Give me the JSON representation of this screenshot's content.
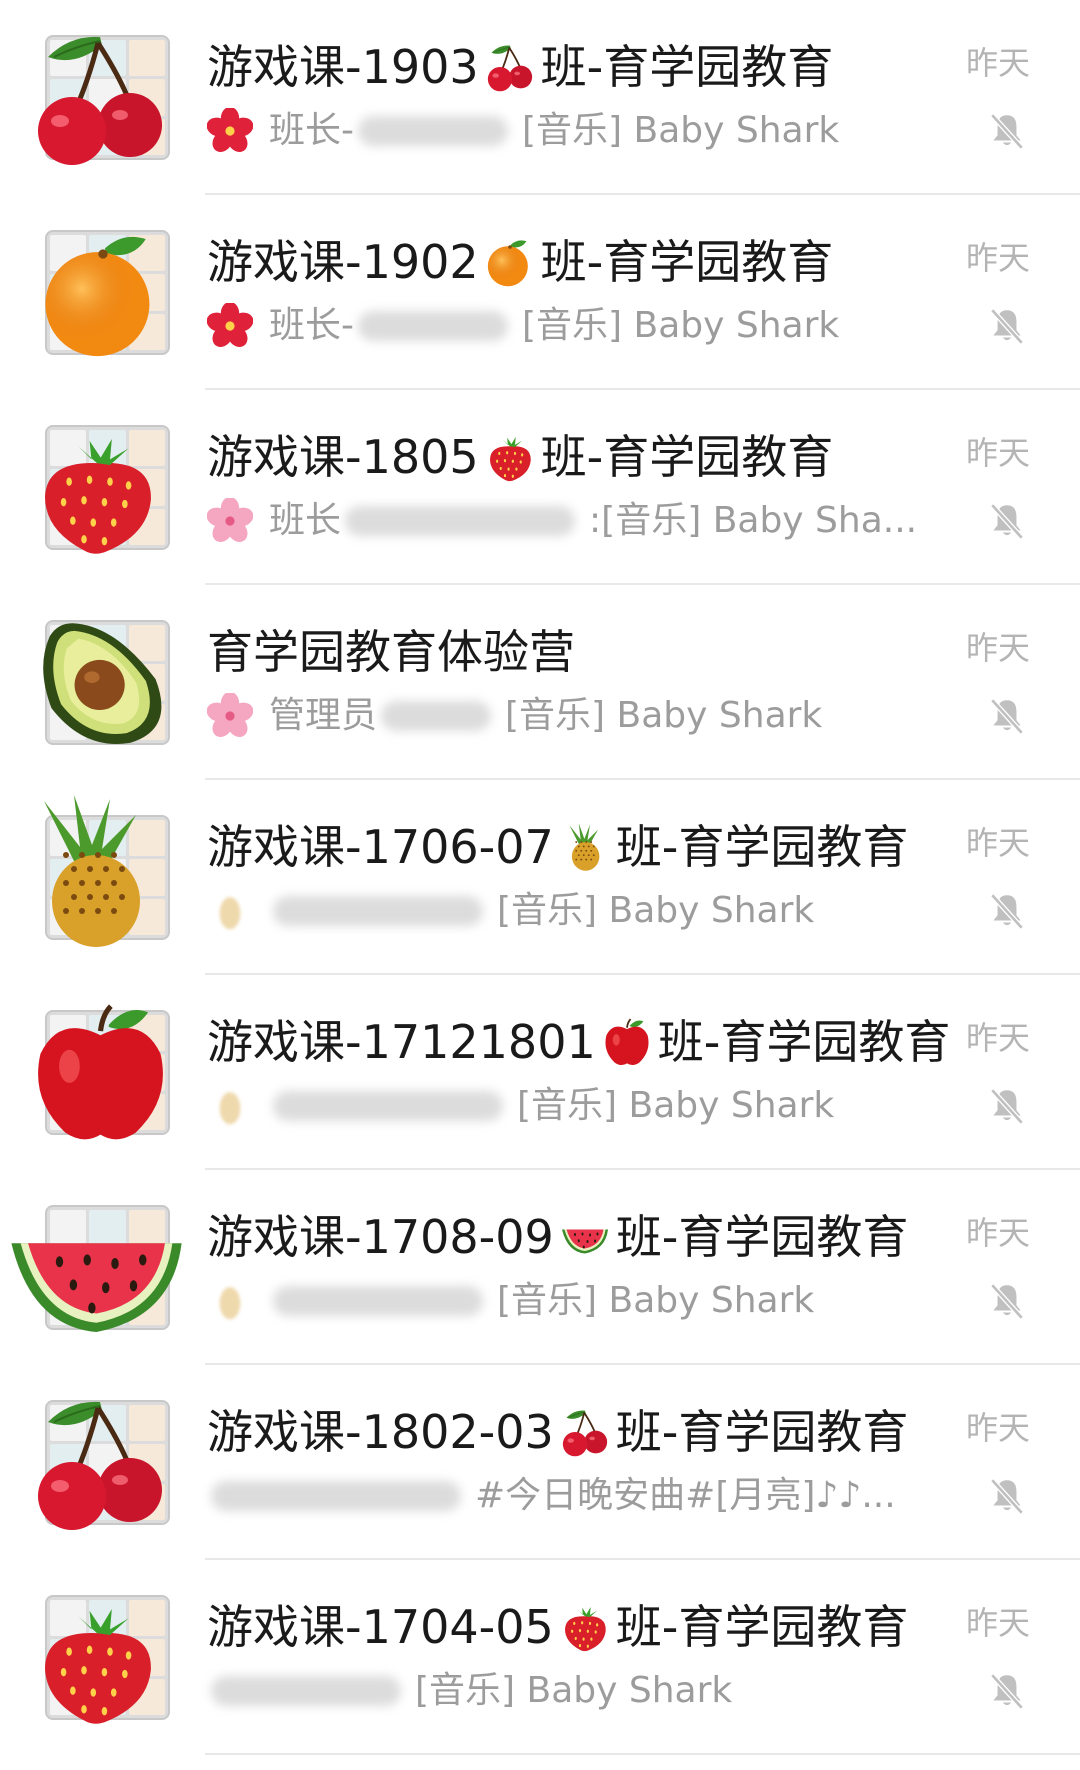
{
  "chats": [
    {
      "title": "游戏课-1903",
      "title_suffix": "班-育学园教育",
      "title_emoji": "cherry-icon",
      "time": "昨天",
      "preview_icon": "hibiscus-icon",
      "preview_role": "班长-",
      "preview_sep": "",
      "preview_text": "[音乐] Baby Shark",
      "muted": true,
      "avatar_fruit": "cherry"
    },
    {
      "title": "游戏课-1902",
      "title_suffix": "班-育学园教育",
      "title_emoji": "orange-icon",
      "time": "昨天",
      "preview_icon": "hibiscus-icon",
      "preview_role": "班长-",
      "preview_sep": "",
      "preview_text": "[音乐] Baby Shark",
      "muted": true,
      "avatar_fruit": "orange"
    },
    {
      "title": "游戏课-1805",
      "title_suffix": "班-育学园教育",
      "title_emoji": "strawberry-icon",
      "time": "昨天",
      "preview_icon": "cherry-blossom-icon",
      "preview_role": "班长",
      "preview_sep": ":",
      "preview_text": "[音乐] Baby Sha...",
      "muted": true,
      "avatar_fruit": "strawberry"
    },
    {
      "title": "育学园教育体验营",
      "title_suffix": "",
      "title_emoji": "",
      "time": "昨天",
      "preview_icon": "cherry-blossom-icon",
      "preview_role": "管理员",
      "preview_sep": "",
      "preview_text": "[音乐] Baby Shark",
      "muted": true,
      "avatar_fruit": "avocado"
    },
    {
      "title": "游戏课-1706-07",
      "title_suffix": "班-育学园教育",
      "title_emoji": "pineapple-icon",
      "time": "昨天",
      "preview_icon": "blurred-icon",
      "preview_role": "",
      "preview_sep": "",
      "preview_text": "[音乐] Baby Shark",
      "muted": true,
      "avatar_fruit": "pineapple"
    },
    {
      "title": "游戏课-17121801",
      "title_suffix": "班-育学园教育",
      "title_emoji": "apple-icon",
      "time": "昨天",
      "preview_icon": "blurred-icon",
      "preview_role": "",
      "preview_sep": "",
      "preview_text": "[音乐] Baby Shark",
      "muted": true,
      "avatar_fruit": "apple"
    },
    {
      "title": "游戏课-1708-09",
      "title_suffix": "班-育学园教育",
      "title_emoji": "watermelon-icon",
      "time": "昨天",
      "preview_icon": "blurred-icon",
      "preview_role": "",
      "preview_sep": "",
      "preview_text": "[音乐] Baby Shark",
      "muted": true,
      "avatar_fruit": "watermelon"
    },
    {
      "title": "游戏课-1802-03",
      "title_suffix": "班-育学园教育",
      "title_emoji": "cherry-icon",
      "time": "昨天",
      "preview_icon": "none",
      "preview_role": "",
      "preview_sep": "",
      "preview_text": "#今日晚安曲#[月亮]♪♪...",
      "muted": true,
      "avatar_fruit": "cherry"
    },
    {
      "title": "游戏课-1704-05",
      "title_suffix": "班-育学园教育",
      "title_emoji": "strawberry-icon",
      "time": "昨天",
      "preview_icon": "none",
      "preview_role": "",
      "preview_sep": "",
      "preview_text": "[音乐] Baby Shark",
      "muted": true,
      "avatar_fruit": "strawberry"
    }
  ],
  "colors": {
    "title": "#1a1a1a",
    "preview": "#9c9c9c",
    "time": "#b4b4b4",
    "divider": "#e8e8e8",
    "mute": "#c0c0c0"
  }
}
